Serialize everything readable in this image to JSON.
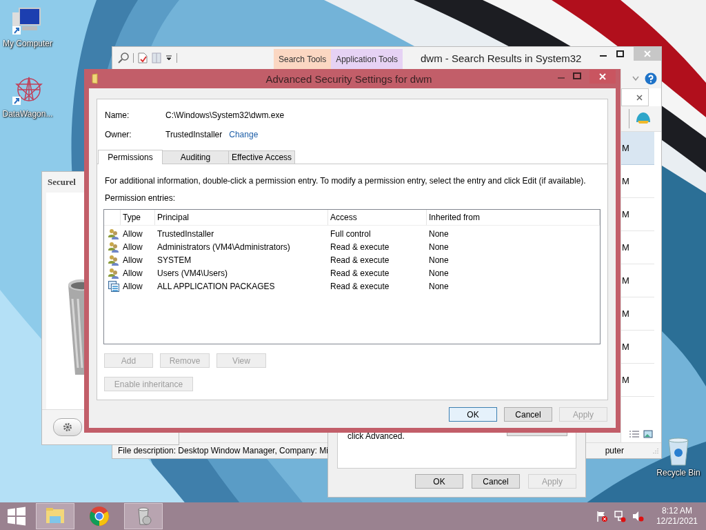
{
  "desktop_icons": [
    {
      "kind": "computer",
      "label": "My Computer"
    },
    {
      "kind": "star",
      "label": "DataWagon..."
    },
    {
      "kind": "bin",
      "label": "Recycle Bin"
    }
  ],
  "explorer": {
    "title": "dwm - Search Results in System32",
    "ribbon_tabs": [
      {
        "label": "Search Tools",
        "color": "#fbd7c2"
      },
      {
        "label": "Application Tools",
        "color": "#e6d2f4"
      }
    ],
    "rows": [
      {
        "text": "M",
        "selected": true
      },
      {
        "text": "M",
        "selected": false
      },
      {
        "text": "M",
        "selected": false
      },
      {
        "text": "M",
        "selected": false
      },
      {
        "text": "M",
        "selected": false
      },
      {
        "text": "M",
        "selected": false
      },
      {
        "text": "M",
        "selected": false
      },
      {
        "text": "M",
        "selected": false
      }
    ],
    "status": "File description: Desktop Window Manager, Company: Mi",
    "status_end": "puter"
  },
  "cleaner": {
    "title": "Securel"
  },
  "properties": {
    "text": "click Advanced.",
    "buttons": [
      {
        "label": "OK",
        "disabled": false
      },
      {
        "label": "Cancel",
        "disabled": false
      },
      {
        "label": "Apply",
        "disabled": true
      }
    ]
  },
  "dialog": {
    "title": "Advanced Security Settings for dwm",
    "name_label": "Name:",
    "name": "C:\\Windows\\System32\\dwm.exe",
    "owner_label": "Owner:",
    "owner": "TrustedInstaller",
    "change_link": "Change",
    "tabs": [
      {
        "label": "Permissions",
        "selected": true
      },
      {
        "label": "Auditing",
        "selected": false
      },
      {
        "label": "Effective Access",
        "selected": false
      }
    ],
    "info": "For additional information, double-click a permission entry. To modify a permission entry, select the entry and click Edit (if available).",
    "entries_label": "Permission entries:",
    "columns": [
      "Type",
      "Principal",
      "Access",
      "Inherited from"
    ],
    "rows": [
      {
        "kind": "users",
        "type": "Allow",
        "principal": "TrustedInstaller",
        "access": "Full control",
        "inherited": "None"
      },
      {
        "kind": "users",
        "type": "Allow",
        "principal": "Administrators (VM4\\Administrators)",
        "access": "Read & execute",
        "inherited": "None"
      },
      {
        "kind": "users",
        "type": "Allow",
        "principal": "SYSTEM",
        "access": "Read & execute",
        "inherited": "None"
      },
      {
        "kind": "users",
        "type": "Allow",
        "principal": "Users (VM4\\Users)",
        "access": "Read & execute",
        "inherited": "None"
      },
      {
        "kind": "package",
        "type": "Allow",
        "principal": "ALL APPLICATION PACKAGES",
        "access": "Read & execute",
        "inherited": "None"
      }
    ],
    "entry_buttons": [
      {
        "label": "Add",
        "disabled": true
      },
      {
        "label": "Remove",
        "disabled": true
      },
      {
        "label": "View",
        "disabled": true
      }
    ],
    "inheritance_button": {
      "label": "Enable inheritance",
      "disabled": true
    },
    "buttons": [
      {
        "label": "OK",
        "disabled": false
      },
      {
        "label": "Cancel",
        "disabled": false
      },
      {
        "label": "Apply",
        "disabled": true
      }
    ]
  },
  "taskbar": {
    "items": [
      {
        "kind": "explorer",
        "selected": true
      },
      {
        "kind": "chrome",
        "selected": false
      },
      {
        "kind": "bin",
        "selected": true
      }
    ],
    "time": "8:12 AM",
    "date": "12/21/2021"
  }
}
